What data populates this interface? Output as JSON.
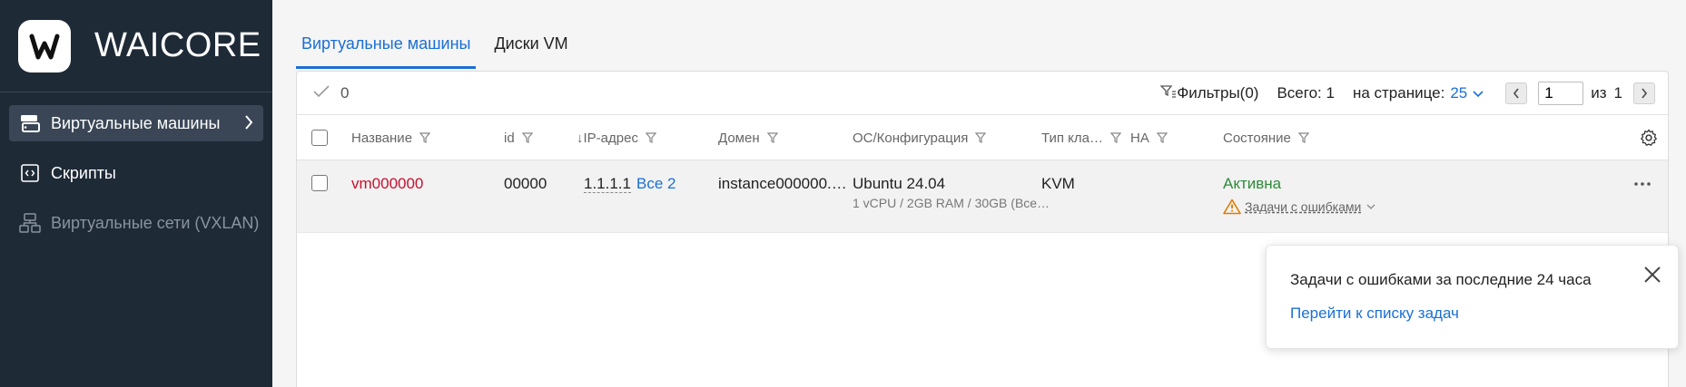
{
  "brand": {
    "name": "WAICORE",
    "logo_letter": "W"
  },
  "sidebar": {
    "items": [
      {
        "label": "Виртуальные машины",
        "icon": "server-icon",
        "active": true
      },
      {
        "label": "Скрипты",
        "icon": "script-icon",
        "active": false
      },
      {
        "label": "Виртуальные сети (VXLAN)",
        "icon": "network-icon",
        "active": false,
        "disabled": true
      }
    ]
  },
  "tabs": [
    {
      "label": "Виртуальные машины",
      "active": true
    },
    {
      "label": "Диски VM",
      "active": false
    }
  ],
  "toolbar": {
    "selected_count": "0",
    "filters_label": "Фильтры(0)",
    "total_label": "Всего: 1",
    "per_page_label": "на странице:",
    "per_page_value": "25",
    "page_value": "1",
    "page_of_label": "из",
    "page_total": "1"
  },
  "table": {
    "columns": [
      {
        "label": "Название"
      },
      {
        "label": "id"
      },
      {
        "label": "IP-адрес",
        "sort_prefix": "↓"
      },
      {
        "label": "Домен"
      },
      {
        "label": "ОС/Конфигурация"
      },
      {
        "label": "Тип кла…"
      },
      {
        "label": "HA"
      },
      {
        "label": "Состояние"
      }
    ],
    "rows": [
      {
        "name": "vm000000",
        "id": "00000",
        "ip": "1.1.1.1",
        "ip_all": "Все 2",
        "domain": "instance000000.…",
        "os": "Ubuntu 24.04",
        "config": "1 vCPU / 2GB RAM / 30GB (Все…",
        "type": "KVM",
        "ha": "",
        "state": "Активна",
        "state_warning": "Задачи с ошибками"
      }
    ]
  },
  "popover": {
    "title": "Задачи с ошибками за последние 24 часа",
    "link": "Перейти к списку задач"
  },
  "colors": {
    "sidebar_bg": "#1f2a37",
    "accent": "#1a6fd6",
    "vm_name": "#c8102e",
    "active_state": "#2e8b3a",
    "warning": "#e07b00"
  }
}
